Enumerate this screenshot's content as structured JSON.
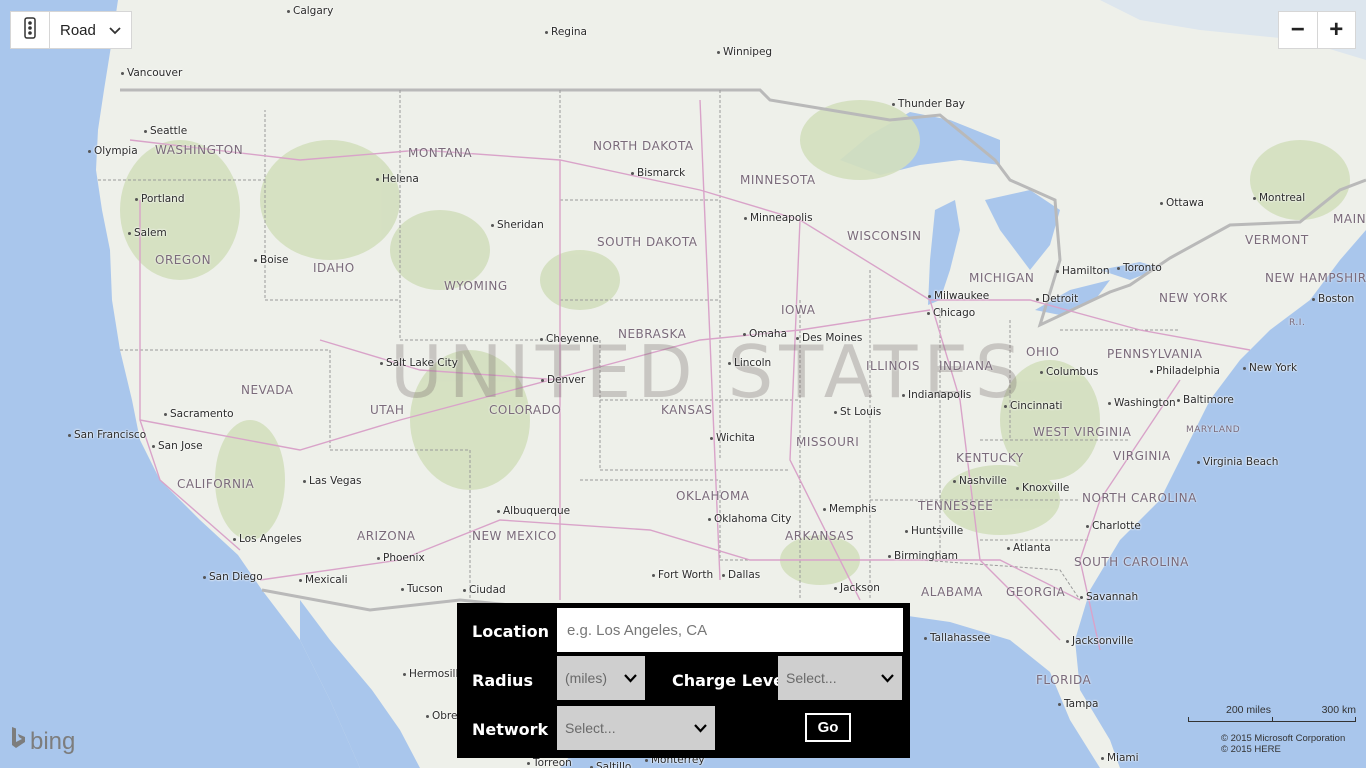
{
  "map": {
    "style_label": "Road",
    "country_label": "UNITED STATES",
    "states": [
      "WASHINGTON",
      "MONTANA",
      "NORTH DAKOTA",
      "MINNESOTA",
      "SOUTH DAKOTA",
      "WISCONSIN",
      "MICHIGAN",
      "OREGON",
      "IDAHO",
      "WYOMING",
      "NEBRASKA",
      "IOWA",
      "NEVADA",
      "UTAH",
      "COLORADO",
      "KANSAS",
      "MISSOURI",
      "ILLINOIS",
      "INDIANA",
      "OHIO",
      "PENNSYLVANIA",
      "NEW YORK",
      "VERMONT",
      "NEW HAMPSHIRE",
      "MAIN",
      "CALIFORNIA",
      "ARIZONA",
      "NEW MEXICO",
      "OKLAHOMA",
      "ARKANSAS",
      "TENNESSEE",
      "KENTUCKY",
      "WEST VIRGINIA",
      "VIRGINIA",
      "NORTH CAROLINA",
      "SOUTH CAROLINA",
      "GEORGIA",
      "ALABAMA",
      "FLORIDA"
    ],
    "cities": [
      "Calgary",
      "Regina",
      "Winnipeg",
      "Vancouver",
      "Thunder Bay",
      "Seattle",
      "Olympia",
      "Bismarck",
      "Helena",
      "Portland",
      "Salem",
      "Sheridan",
      "Minneapolis",
      "Boise",
      "Ottawa",
      "Montreal",
      "Hamilton",
      "Toronto",
      "Milwaukee",
      "Chicago",
      "Detroit",
      "Boston",
      "Cheyenne",
      "Omaha",
      "Des Moines",
      "Salt Lake City",
      "Lincoln",
      "Denver",
      "Columbus",
      "Philadelphia",
      "New York",
      "Indianapolis",
      "Sacramento",
      "St Louis",
      "Cincinnati",
      "Washington",
      "Baltimore",
      "San Francisco",
      "San Jose",
      "Wichita",
      "Virginia Beach",
      "Nashville",
      "Knoxville",
      "Las Vegas",
      "Albuquerque",
      "Memphis",
      "Charlotte",
      "Oklahoma City",
      "Huntsville",
      "Los Angeles",
      "Phoenix",
      "Birmingham",
      "Atlanta",
      "San Diego",
      "Mexicali",
      "Tucson",
      "Ciudad",
      "Fort Worth",
      "Dallas",
      "Jackson",
      "Savannah",
      "Tallahassee",
      "Jacksonville",
      "Hermosillo",
      "Obrego",
      "Tampa",
      "Miami",
      "Torreon",
      "Saltillo",
      "Monterrey"
    ],
    "province_abbr": [
      "R.I.",
      "MARYLAND"
    ]
  },
  "controls": {
    "traffic_icon": "traffic-light-icon",
    "zoom_out": "−",
    "zoom_in": "+"
  },
  "attribution": {
    "brand": "bing",
    "scale_miles": "200 miles",
    "scale_km": "300 km",
    "copyright_1": "© 2015 Microsoft Corporation",
    "copyright_2": "© 2015 HERE"
  },
  "search_panel": {
    "location_label": "Location",
    "location_placeholder": "e.g. Los Angeles, CA",
    "radius_label": "Radius",
    "radius_value": "(miles)",
    "charge_label": "Charge Level",
    "charge_value": "Select...",
    "network_label": "Network",
    "network_value": "Select...",
    "go_label": "Go"
  }
}
